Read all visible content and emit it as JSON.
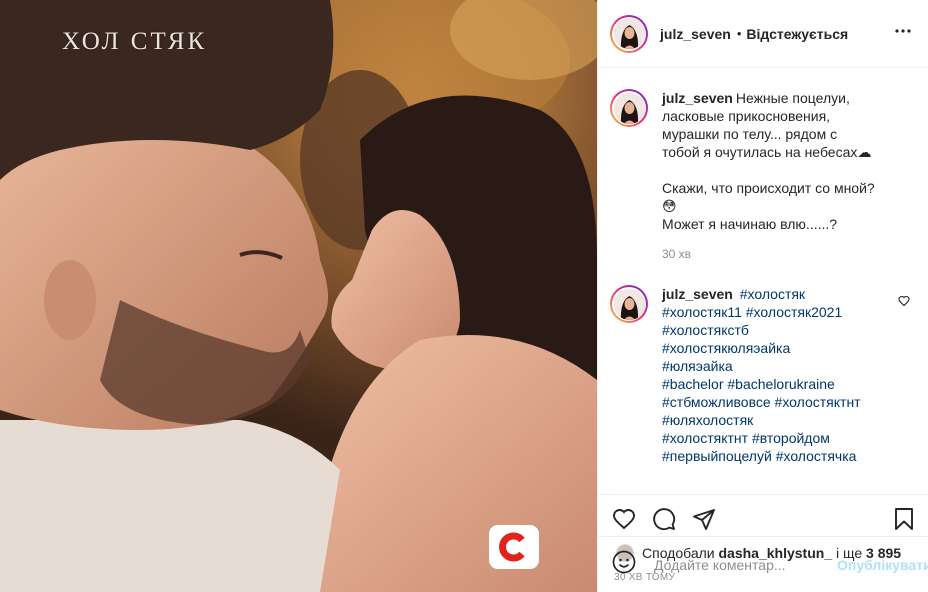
{
  "photo": {
    "show_logo_text": "ХОЛ СТЯК",
    "channel_logo_letter": "С"
  },
  "header": {
    "username": "julz_seven",
    "dot": "•",
    "follow_label": "Відстежується",
    "more_icon": "more-dots-icon"
  },
  "caption": {
    "username": "julz_seven",
    "lines": [
      "Нежные поцелуи, ласковые прикосновения, мурашки по телу... рядом с тобой я очутилась на небесах☁",
      "",
      "Скажи, что происходит со мной?😳",
      "Может я начинаю влю......?"
    ],
    "time": "30 хв"
  },
  "comment": {
    "username": "julz_seven",
    "hashtags": [
      "#холостяк",
      "#холостяк11",
      "#холостяк2021",
      "#холостякстб",
      "#холостякюляэайка",
      "#юляэайка",
      "#bachelor",
      "#bachelorukraine",
      "#стбможливовсе",
      "#холостяктнт",
      "#юляхолостяк",
      "#холостяктнт",
      "#второйдом",
      "#первыйпоцелуй",
      "#холостячка"
    ]
  },
  "likes": {
    "prefix": "Сподобали",
    "liker": "dasha_khlystun_",
    "middle": "і ще",
    "count": "3 895"
  },
  "post_time": "30 ХВ ТОМУ",
  "add_comment": {
    "placeholder": "Додайте коментар...",
    "publish_label": "Опублікувати"
  },
  "colors": {
    "link": "#00376b",
    "publish_disabled": "#b2dffc",
    "muted": "#8e8e8e"
  }
}
